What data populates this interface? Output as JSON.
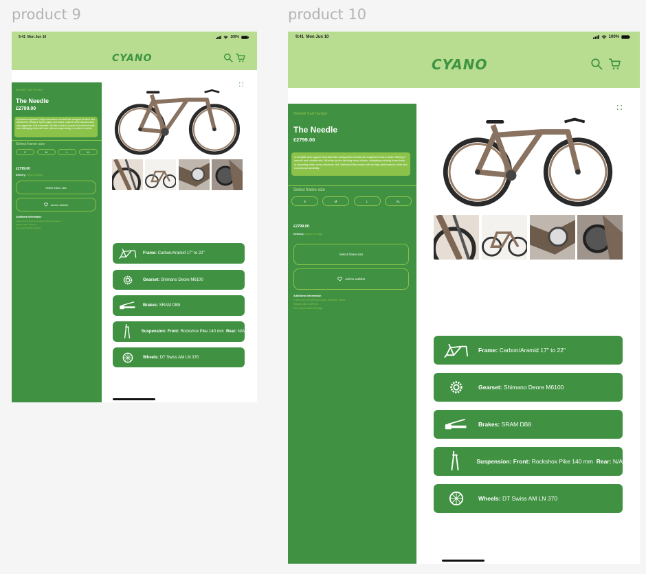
{
  "artboards": [
    {
      "label": "product 9",
      "status": {
        "time": "9:41",
        "date": "Mon Jun 10",
        "battery": "100%"
      },
      "logo": "CYANO",
      "breadcrumb": "Bike/All/ Trail/ Hardtail",
      "product": {
        "name": "The Needle",
        "price": "£2799.00"
      },
      "description": "A precision-engineered, high-performance mountain bike designed for riders who demand the ultimate in speed, agility, and control. Inspired by the natural beauty and ruggedness of its namesake, this bike is built to conquer both technical trails and challenging climbs with ease, without compromising on comfort or control.",
      "size_label": "Select frame size",
      "sizes": [
        "S",
        "M",
        "L",
        "XL"
      ],
      "summary_price": "£2799.00",
      "delivery_label": "Delivery:",
      "delivery_value": "Ships 3-5 days",
      "select_frame_button": "Select frame size",
      "wishlist_button": "Add to wishlist",
      "additional_title": "Additional information",
      "additional_lines": [
        "Frame and fork with rear shock, Shimano, Deore",
        "Shipped 48h, 100% Kit",
        "Free returns within 30 days"
      ],
      "specs": [
        {
          "icon": "bike-frame-icon",
          "label": "Frame:",
          "value": "Carbon/Aramid 17\" to 22\"",
          "label2": "",
          "value2": ""
        },
        {
          "icon": "gear-icon",
          "label": "Gearset:",
          "value": "Shimano Deore M6100",
          "label2": "",
          "value2": ""
        },
        {
          "icon": "brake-lever-icon",
          "label": "Brakes:",
          "value": "SRAM DB8",
          "label2": "",
          "value2": ""
        },
        {
          "icon": "suspension-fork-icon",
          "label": "Suspension: Front:",
          "value": "Rockshox Pike 140 mm",
          "label2": "Rear:",
          "value2": "N/A"
        },
        {
          "icon": "wheel-icon",
          "label": "Wheels:",
          "value": "DT Swiss AM LN 370",
          "label2": "",
          "value2": ""
        }
      ]
    },
    {
      "label": "product 10",
      "status": {
        "time": "9:41",
        "date": "Mon Jun 10",
        "battery": "100%"
      },
      "logo": "CYANO",
      "breadcrumb": "Bike/All/ Trail/ Hardtail",
      "product": {
        "name": "The Needle",
        "price": "£2799.00"
      },
      "description": "A versatile and rugged mountain bike designed to handle the toughest terrains while offering a smooth and reliable ride. Whether you're tackling steep climbs, navigating winding forest trails, or speeding down rocky descents, the Oakhead Bike excels with its high-performance build and exceptional durability.",
      "size_label": "Select frame size",
      "sizes": [
        "S",
        "M",
        "L",
        "XL"
      ],
      "summary_price": "£2799.00",
      "delivery_label": "Delivery:",
      "delivery_value": "Ships 3-5 days",
      "select_frame_button": "Select frame size",
      "wishlist_button": "Add to wishlist",
      "additional_title": "Additional information",
      "additional_lines": [
        "Frame and fork with rear shock, Shimano, Deore",
        "Shipped 48h, 100% Kit",
        "Free returns within 30 days"
      ],
      "specs": [
        {
          "icon": "bike-frame-icon",
          "label": "Frame:",
          "value": "Carbon/Aramid 17\" to 22\"",
          "label2": "",
          "value2": ""
        },
        {
          "icon": "gear-icon",
          "label": "Gearset:",
          "value": "Shimano Deore M6100",
          "label2": "",
          "value2": ""
        },
        {
          "icon": "brake-lever-icon",
          "label": "Brakes:",
          "value": "SRAM DB8",
          "label2": "",
          "value2": ""
        },
        {
          "icon": "suspension-fork-icon",
          "label": "Suspension: Front:",
          "value": "Rockshox Pike 140 mm",
          "label2": "Rear:",
          "value2": "N/A"
        },
        {
          "icon": "wheel-icon",
          "label": "Wheels:",
          "value": "DT Swiss AM LN 370",
          "label2": "",
          "value2": ""
        }
      ]
    }
  ],
  "colors": {
    "header": "#b9dd90",
    "panel": "#409242",
    "accent": "#8bc34a",
    "logo": "#3e9442"
  }
}
